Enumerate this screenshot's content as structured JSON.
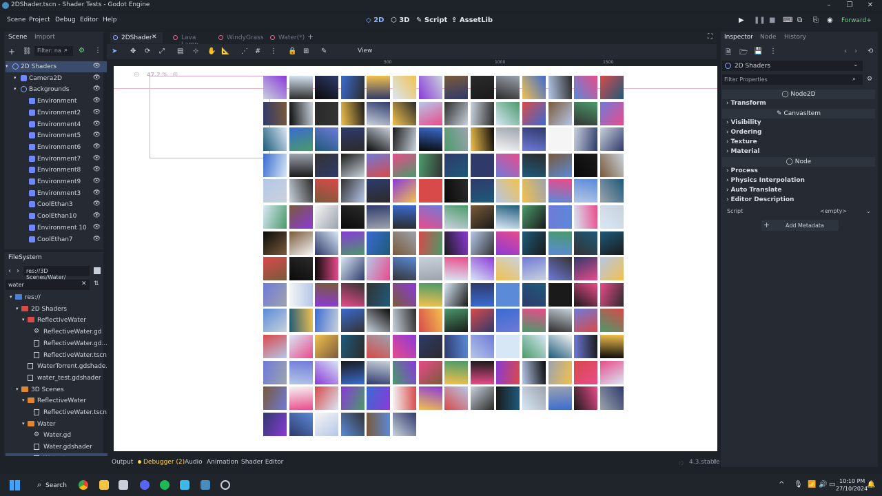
{
  "window": {
    "title": "2DShader.tscn - Shader Tests - Godot Engine",
    "renderer": "Forward+"
  },
  "menu": [
    "Scene",
    "Project",
    "Debug",
    "Editor",
    "Help"
  ],
  "workspaces": [
    {
      "label": "2D",
      "icon": "2d-icon",
      "active": true
    },
    {
      "label": "3D",
      "icon": "3d-icon",
      "active": false
    },
    {
      "label": "Script",
      "icon": "script-icon",
      "active": false
    },
    {
      "label": "AssetLib",
      "icon": "assetlib-icon",
      "active": false
    }
  ],
  "scene_dock": {
    "tabs": [
      "Scene",
      "Import"
    ],
    "filter_placeholder": "Filter: na",
    "tree": [
      {
        "label": "2D Shaders",
        "depth": 0,
        "icon": "circle"
      },
      {
        "label": "Camera2D",
        "depth": 1,
        "icon": "square"
      },
      {
        "label": "Backgrounds",
        "depth": 1,
        "icon": "circle"
      },
      {
        "label": "Environment",
        "depth": 2,
        "icon": "square"
      },
      {
        "label": "Environment2",
        "depth": 2,
        "icon": "square"
      },
      {
        "label": "Environment4",
        "depth": 2,
        "icon": "square"
      },
      {
        "label": "Environment5",
        "depth": 2,
        "icon": "square"
      },
      {
        "label": "Environment6",
        "depth": 2,
        "icon": "square"
      },
      {
        "label": "Environment7",
        "depth": 2,
        "icon": "square"
      },
      {
        "label": "Environment8",
        "depth": 2,
        "icon": "square"
      },
      {
        "label": "Environment9",
        "depth": 2,
        "icon": "square"
      },
      {
        "label": "Environment3",
        "depth": 2,
        "icon": "square"
      },
      {
        "label": "CoolEthan3",
        "depth": 2,
        "icon": "square"
      },
      {
        "label": "CoolEthan10",
        "depth": 2,
        "icon": "square"
      },
      {
        "label": "Environment 10",
        "depth": 2,
        "icon": "square"
      },
      {
        "label": "CoolEthan7",
        "depth": 2,
        "icon": "square"
      }
    ]
  },
  "filesystem": {
    "title": "FileSystem",
    "path": "res://3D Scenes/Water/",
    "search": "water",
    "items": [
      {
        "label": "res://",
        "depth": 0,
        "kind": "folder",
        "color": "#4a7fd6"
      },
      {
        "label": "2D Shaders",
        "depth": 1,
        "kind": "folder",
        "color": "#d94a4a"
      },
      {
        "label": "ReflectiveWater",
        "depth": 2,
        "kind": "folder",
        "color": "#d94a4a"
      },
      {
        "label": "ReflectiveWater.gd",
        "depth": 3,
        "kind": "gear"
      },
      {
        "label": "ReflectiveWater.gd...",
        "depth": 3,
        "kind": "file"
      },
      {
        "label": "ReflectiveWater.tscn",
        "depth": 3,
        "kind": "file"
      },
      {
        "label": "WaterTorrent.gdshade...",
        "depth": 2,
        "kind": "file"
      },
      {
        "label": "water_test.gdshader",
        "depth": 2,
        "kind": "file"
      },
      {
        "label": "3D Scenes",
        "depth": 1,
        "kind": "folder",
        "color": "#e0862f"
      },
      {
        "label": "ReflectiveWater",
        "depth": 2,
        "kind": "folder",
        "color": "#e0862f"
      },
      {
        "label": "ReflectiveWater.tscn",
        "depth": 3,
        "kind": "file"
      },
      {
        "label": "Water",
        "depth": 2,
        "kind": "folder",
        "color": "#e0862f"
      },
      {
        "label": "Water.gd",
        "depth": 3,
        "kind": "gear"
      },
      {
        "label": "Water.gdshader",
        "depth": 3,
        "kind": "file"
      },
      {
        "label": "Water.tscn",
        "depth": 3,
        "kind": "file",
        "selected": true
      }
    ]
  },
  "scene_tabs": [
    {
      "label": "2DShader",
      "active": true,
      "color": "#8da5ff"
    },
    {
      "label": "Lava Lamp",
      "active": false,
      "color": "#ff5a8a"
    },
    {
      "label": "WindyGrass",
      "active": false,
      "color": "#ff5a8a"
    },
    {
      "label": "Water(*)",
      "active": false,
      "color": "#ff5a8a"
    }
  ],
  "toolbar": {
    "view_label": "View"
  },
  "ruler": {
    "marks": [
      "500",
      "1000",
      "1500"
    ]
  },
  "zoom": {
    "label": "47.2 %"
  },
  "inspector": {
    "tabs": [
      "Inspector",
      "Node",
      "History"
    ],
    "object_name": "2D Shaders",
    "filter_placeholder": "Filter Properties",
    "sections": [
      {
        "type": "header",
        "label": "Node2D"
      },
      {
        "type": "prop",
        "label": "Transform"
      },
      {
        "type": "header",
        "label": "CanvasItem"
      },
      {
        "type": "prop",
        "label": "Visibility"
      },
      {
        "type": "prop",
        "label": "Ordering"
      },
      {
        "type": "prop",
        "label": "Texture"
      },
      {
        "type": "prop",
        "label": "Material"
      },
      {
        "type": "header",
        "label": "Node"
      },
      {
        "type": "prop",
        "label": "Process"
      },
      {
        "type": "prop",
        "label": "Physics Interpolation"
      },
      {
        "type": "prop",
        "label": "Auto Translate"
      },
      {
        "type": "prop",
        "label": "Editor Description"
      }
    ],
    "script_label": "Script",
    "script_value": "<empty>",
    "add_metadata": "Add Metadata"
  },
  "bottom_panel": {
    "tabs": [
      "Output",
      "Debugger (2)",
      "Audio",
      "Animation",
      "Shader Editor"
    ],
    "version": "4.3.stable"
  },
  "taskbar": {
    "search_label": "Search",
    "time": "10:10 PM",
    "date": "27/10/2024"
  },
  "colors": {
    "accent": "#8ab4ff",
    "panel": "#262b33",
    "viewport_bg": "#ffffff"
  }
}
